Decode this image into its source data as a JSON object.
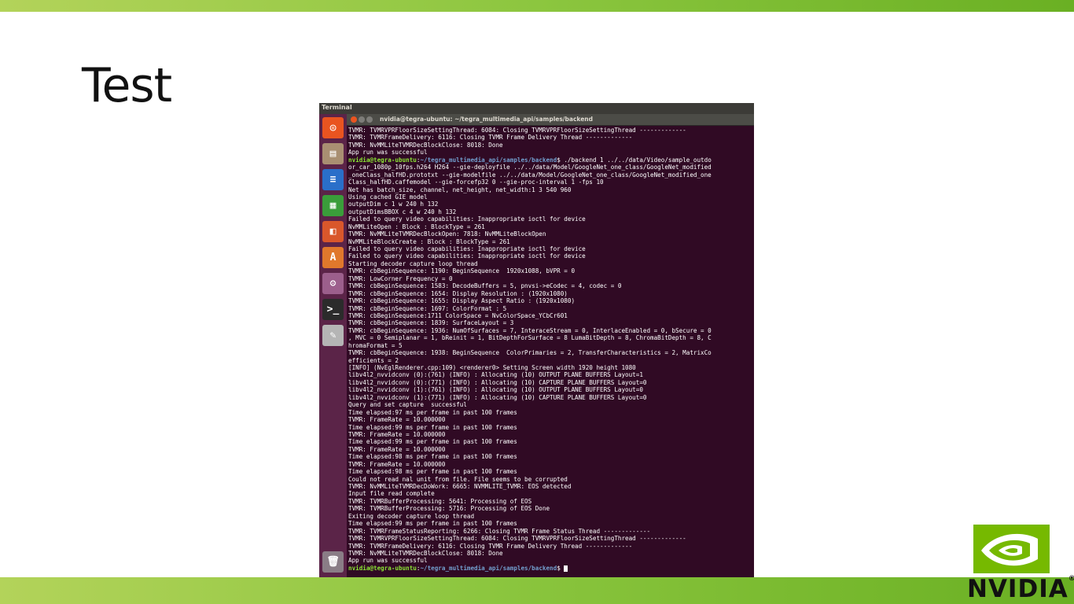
{
  "slide": {
    "title": "Test",
    "logo_text": "NVIDIA",
    "logo_mark": "®",
    "colors": {
      "accent_green": "#76b900",
      "bar_light": "#b3d35a",
      "bar_dark": "#6ab023"
    }
  },
  "desktop": {
    "panel_title": "Terminal",
    "launcher": [
      {
        "name": "ubuntu-dash-icon",
        "glyph": "◎",
        "color": "#e95420"
      },
      {
        "name": "files-icon",
        "glyph": "▤",
        "color": "#a98f72"
      },
      {
        "name": "writer-icon",
        "glyph": "≡",
        "color": "#2a6fc9"
      },
      {
        "name": "calc-icon",
        "glyph": "▦",
        "color": "#3a9d3a"
      },
      {
        "name": "impress-icon",
        "glyph": "◧",
        "color": "#d9572b"
      },
      {
        "name": "software-center-icon",
        "glyph": "A",
        "color": "#e0782c"
      },
      {
        "name": "system-settings-icon",
        "glyph": "⚙",
        "color": "#9c5f8c"
      },
      {
        "name": "terminal-icon",
        "glyph": ">_",
        "color": "#2b2b2b"
      },
      {
        "name": "text-editor-icon",
        "glyph": "✎",
        "color": "#b5b5b5"
      },
      {
        "name": "trash-icon",
        "glyph": "🗑",
        "color": "#8a7d86"
      }
    ]
  },
  "terminal": {
    "window_title": "nvidia@tegra-ubuntu: ~/tegra_multimedia_api/samples/backend",
    "prompt_user": "nvidia@tegra-ubuntu",
    "prompt_path": "~/tegra_multimedia_api/samples/backend",
    "lines": [
      "TVMR: TVMRVPRFloorSizeSettingThread: 6084: Closing TVMRVPRFloorSizeSettingThread -------------",
      "TVMR: TVMRFrameDelivery: 6116: Closing TVMR Frame Delivery Thread -------------",
      "TVMR: NvMMLiteTVMRDecBlockClose: 8018: Done",
      "App run was successful",
      "$ ./backend 1 ../../data/Video/sample_outdo",
      "or_car_1080p_10fps.h264 H264 --gie-deployfile ../../data/Model/GoogleNet_one_class/GoogleNet_modified",
      "_oneClass_halfHD.prototxt --gie-modelfile ../../data/Model/GoogleNet_one_class/GoogleNet_modified_one",
      "Class_halfHD.caffemodel --gie-forcefp32 0 --gie-proc-interval 1 -fps 10",
      "Net has batch_size, channel, net_height, net_width:1 3 540 960",
      "Using cached GIE model",
      "outputDim c 1 w 240 h 132",
      "outputDimsBBOX c 4 w 240 h 132",
      "Failed to query video capabilities: Inappropriate ioctl for device",
      "NvMMLiteOpen : Block : BlockType = 261",
      "TVMR: NvMMLiteTVMRDecBlockOpen: 7818: NvMMLiteBlockOpen",
      "NvMMLiteBlockCreate : Block : BlockType = 261",
      "Failed to query video capabilities: Inappropriate ioctl for device",
      "Failed to query video capabilities: Inappropriate ioctl for device",
      "Starting decoder capture loop thread",
      "TVMR: cbBeginSequence: 1190: BeginSequence  1920x1088, bVPR = 0",
      "TVMR: LowCorner Frequency = 0",
      "TVMR: cbBeginSequence: 1583: DecodeBuffers = 5, pnvsi->eCodec = 4, codec = 0",
      "TVMR: cbBeginSequence: 1654: Display Resolution : (1920x1080)",
      "TVMR: cbBeginSequence: 1655: Display Aspect Ratio : (1920x1080)",
      "TVMR: cbBeginSequence: 1697: ColorFormat : 5",
      "TVMR: cbBeginSequence:1711 ColorSpace = NvColorSpace_YCbCr601",
      "TVMR: cbBeginSequence: 1839: SurfaceLayout = 3",
      "TVMR: cbBeginSequence: 1936: NumOfSurfaces = 7, InteraceStream = 0, InterlaceEnabled = 0, bSecure = 0",
      ", MVC = 0 Semiplanar = 1, bReinit = 1, BitDepthForSurface = 8 LumaBitDepth = 8, ChromaBitDepth = 8, C",
      "hromaFormat = 5",
      "TVMR: cbBeginSequence: 1938: BeginSequence  ColorPrimaries = 2, TransferCharacteristics = 2, MatrixCo",
      "efficients = 2",
      "[INFO] (NvEglRenderer.cpp:109) <renderer0> Setting Screen width 1920 height 1080",
      "libv4l2_nvvidconv (0):(761) (INFO) : Allocating (10) OUTPUT PLANE BUFFERS Layout=1",
      "libv4l2_nvvidconv (0):(771) (INFO) : Allocating (10) CAPTURE PLANE BUFFERS Layout=0",
      "libv4l2_nvvidconv (1):(761) (INFO) : Allocating (10) OUTPUT PLANE BUFFERS Layout=0",
      "libv4l2_nvvidconv (1):(771) (INFO) : Allocating (10) CAPTURE PLANE BUFFERS Layout=0",
      "Query and set capture  successful",
      "Time elapsed:97 ms per frame in past 100 frames",
      "TVMR: FrameRate = 10.000000",
      "Time elapsed:99 ms per frame in past 100 frames",
      "TVMR: FrameRate = 10.000000",
      "Time elapsed:99 ms per frame in past 100 frames",
      "TVMR: FrameRate = 10.000000",
      "Time elapsed:98 ms per frame in past 100 frames",
      "TVMR: FrameRate = 10.000000",
      "Time elapsed:98 ms per frame in past 100 frames",
      "Could not read nal unit from file. File seems to be corrupted",
      "TVMR: NvMMLiteTVMRDecDoWork: 6665: NVMMLITE_TVMR: EOS detected",
      "Input file read complete",
      "TVMR: TVMRBufferProcessing: 5641: Processing of EOS",
      "TVMR: TVMRBufferProcessing: 5716: Processing of EOS Done",
      "Exiting decoder capture loop thread",
      "Time elapsed:99 ms per frame in past 100 frames",
      "TVMR: TVMRFrameStatusReporting: 6266: Closing TVMR Frame Status Thread -------------",
      "TVMR: TVMRVPRFloorSizeSettingThread: 6084: Closing TVMRVPRFloorSizeSettingThread -------------",
      "TVMR: TVMRFrameDelivery: 6116: Closing TVMR Frame Delivery Thread -------------",
      "TVMR: NvMMLiteTVMRDecBlockClose: 8018: Done",
      "App run was successful",
      "$ "
    ]
  }
}
